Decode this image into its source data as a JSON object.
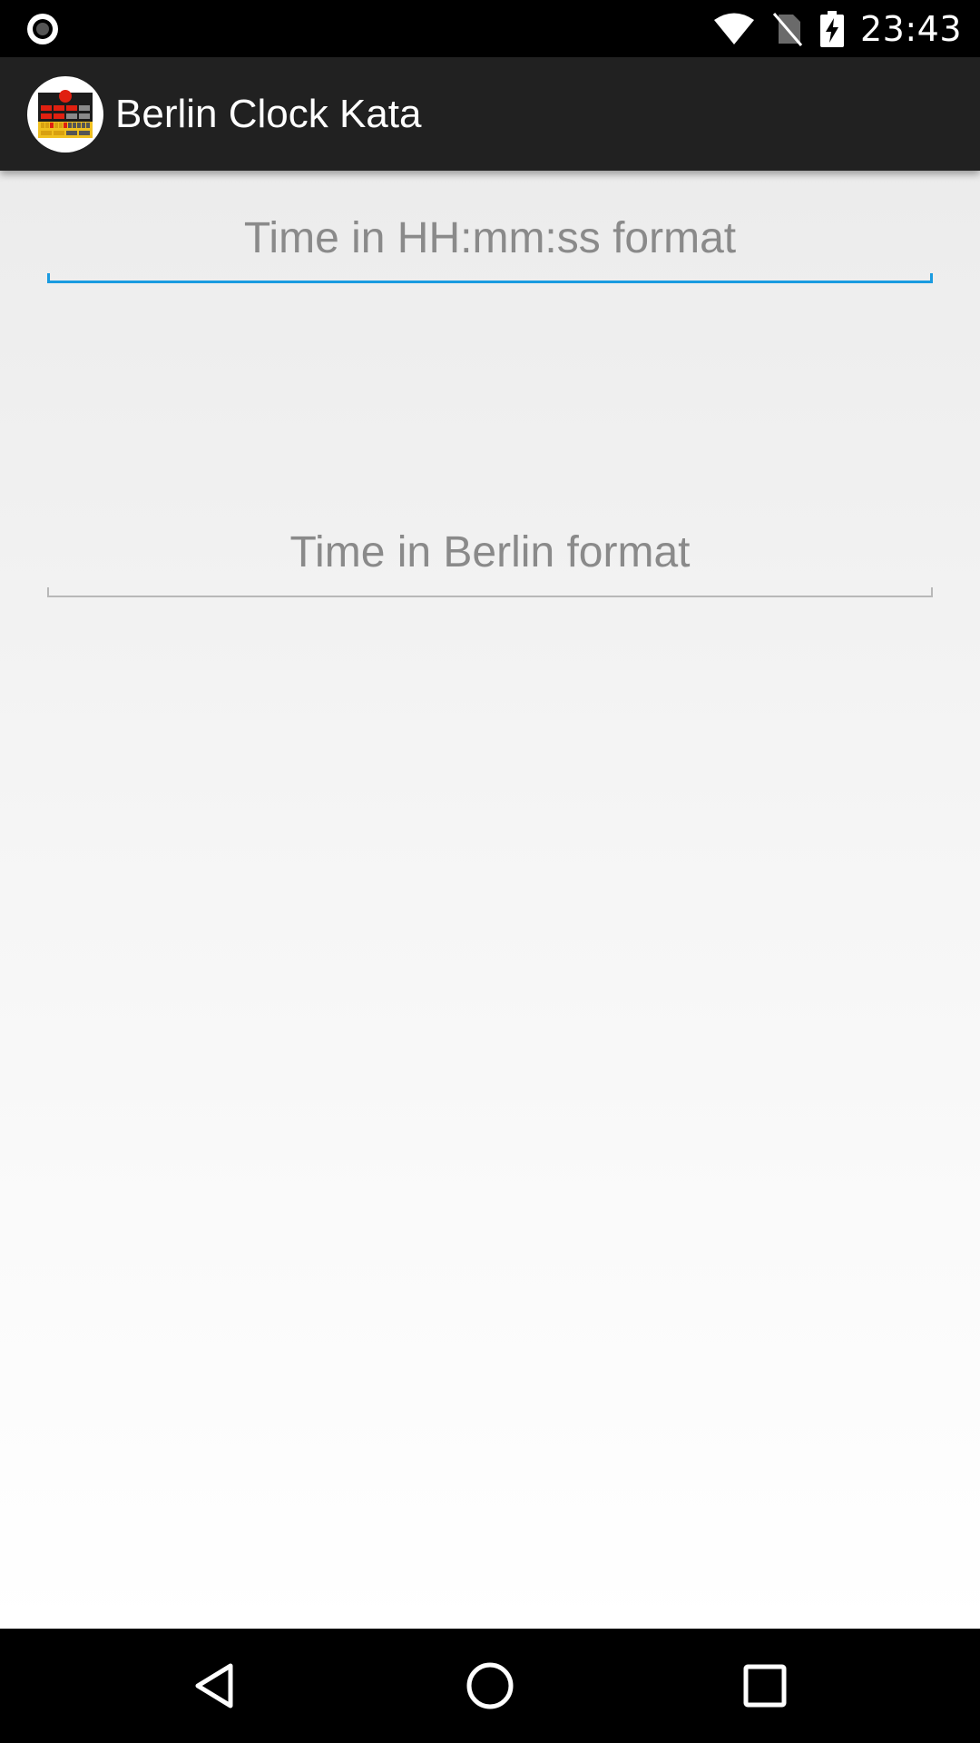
{
  "status_bar": {
    "time": "23:43",
    "icons": [
      "record-icon",
      "wifi-icon",
      "no-sim-icon",
      "battery-charging-icon"
    ]
  },
  "app_bar": {
    "title": "Berlin Clock Kata",
    "icon": "berlin-clock-app-icon",
    "background": "#212121"
  },
  "form": {
    "time_input": {
      "value": "",
      "placeholder": "Time in HH:mm:ss format",
      "focused": true
    },
    "berlin_output": {
      "value": "",
      "placeholder": "Time in Berlin format",
      "focused": false
    }
  },
  "nav_bar": {
    "buttons": [
      "back-icon",
      "home-icon",
      "recents-icon"
    ]
  },
  "colors": {
    "accent": "#1a9be0",
    "inactive_line": "#b8b8b8",
    "placeholder": "#8a8a8a"
  }
}
